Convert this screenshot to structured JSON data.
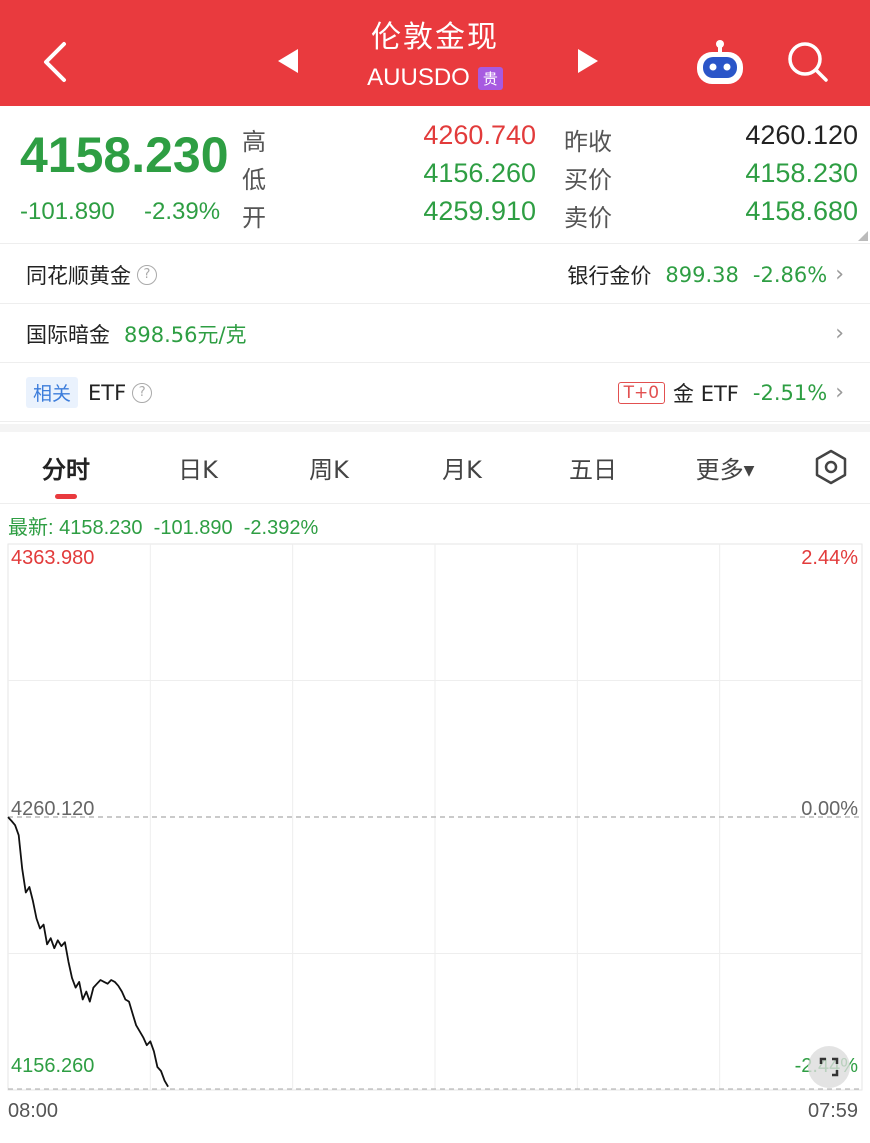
{
  "header": {
    "title": "伦敦金现",
    "symbol": "AUUSDO",
    "badge": "贵"
  },
  "quote": {
    "last": "4158.230",
    "change": "-101.890",
    "change_pct": "-2.39%",
    "labels": {
      "high": "高",
      "low": "低",
      "open": "开",
      "prev_close": "昨收",
      "bid": "买价",
      "ask": "卖价"
    },
    "high": "4260.740",
    "low": "4156.260",
    "open": "4259.910",
    "prev_close": "4260.120",
    "bid": "4158.230",
    "ask": "4158.680"
  },
  "rows": {
    "ths_gold": {
      "label": "同花顺黄金",
      "bank_label": "银行金价",
      "bank_price": "899.38",
      "bank_change": "-2.86%"
    },
    "intl_dark": {
      "label": "国际暗金",
      "value": "898.56元/克"
    },
    "etf": {
      "tag": "相关",
      "label": "ETF",
      "t0": "T+0",
      "name": "金 ETF",
      "change": "-2.51%"
    }
  },
  "tabs": [
    "分时",
    "日K",
    "周K",
    "月K",
    "五日",
    "更多"
  ],
  "chart_header": {
    "prefix": "最新:",
    "price": "4158.230",
    "change": "-101.890",
    "pct": "-2.392%"
  },
  "colors": {
    "brand": "#e93a3e",
    "up": "#e23b3b",
    "down": "#2e9e43"
  },
  "chart_data": {
    "type": "line",
    "x_start": "08:00",
    "x_end": "07:59",
    "y_top_label": "4363.980",
    "y_mid_label": "4260.120",
    "y_bottom_label": "4156.260",
    "pct_top_label": "2.44%",
    "pct_mid_label": "0.00%",
    "pct_bottom_label": "-2.44%",
    "ylim": [
      4156.26,
      4363.98
    ],
    "prev_close": 4260.12,
    "grid": true,
    "series": [
      {
        "values": [
          4260.1,
          4258.6,
          4257.0,
          4253.2,
          4240.4,
          4231.4,
          4233.5,
          4228.2,
          4221.5,
          4217.7,
          4219.2,
          4211.7,
          4214.0,
          4210.2,
          4213.2,
          4211.0,
          4212.5,
          4205.0,
          4198.9,
          4195.2,
          4197.4,
          4190.7,
          4193.7,
          4189.9,
          4195.2,
          4196.7,
          4198.1,
          4197.4,
          4196.7,
          4198.1,
          4197.4,
          4195.9,
          4193.7,
          4190.7,
          4189.9,
          4185.4,
          4180.9,
          4178.6,
          4176.3,
          4173.3,
          4174.8,
          4171.0,
          4165.0,
          4163.5,
          4159.8,
          4157.5
        ]
      }
    ]
  }
}
